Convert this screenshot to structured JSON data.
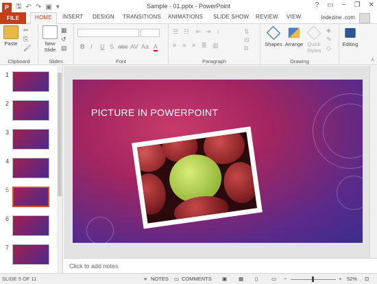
{
  "window": {
    "title": "Sample - 01.pptx - PowerPoint",
    "help": "?",
    "minimize": "−",
    "restore": "❐",
    "close": "✕"
  },
  "tabs": {
    "file": "FILE",
    "home": "HOME",
    "insert": "INSERT",
    "design": "DESIGN",
    "transitions": "TRANSITIONS",
    "animations": "ANIMATIONS",
    "slideshow": "SLIDE SHOW",
    "review": "REVIEW",
    "view": "VIEW"
  },
  "account": {
    "user": "Indezine .com"
  },
  "ribbon": {
    "clipboard": {
      "label": "Clipboard",
      "paste": "Paste"
    },
    "slides": {
      "label": "Slides",
      "new_slide": "New Slide"
    },
    "font": {
      "label": "Font",
      "bold": "B",
      "italic": "I",
      "underline": "U",
      "shadow": "S",
      "strike": "abc",
      "spacing": "AV",
      "case": "Aa",
      "color": "A"
    },
    "paragraph": {
      "label": "Paragraph"
    },
    "drawing": {
      "label": "Drawing",
      "shapes": "Shapes",
      "arrange": "Arrange",
      "quick_styles": "Quick Styles"
    },
    "editing": {
      "label": "Editing"
    }
  },
  "thumbnails": {
    "items": [
      "1",
      "2",
      "3",
      "4",
      "5",
      "6",
      "7"
    ],
    "selected": "5"
  },
  "slide": {
    "title": "PICTURE IN POWERPOINT"
  },
  "notes": {
    "placeholder": "Click to add notes"
  },
  "status": {
    "slide_of": "SLIDE 5 OF 11",
    "notes": "NOTES",
    "comments": "COMMENTS",
    "zoom": "52%",
    "zoom_minus": "−",
    "zoom_plus": "+"
  },
  "colors": {
    "accent": "#c43e1c",
    "slide_bg_top": "#a32560",
    "slide_bg_bottom": "#3b2d8c"
  }
}
